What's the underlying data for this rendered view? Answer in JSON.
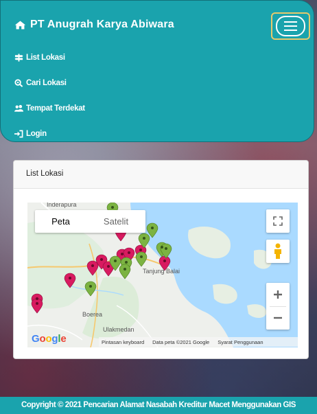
{
  "navbar": {
    "brand": "PT Anugrah Karya Abiwara",
    "links": [
      {
        "label": "List Lokasi",
        "icon": "signpost-icon"
      },
      {
        "label": "Cari Lokasi",
        "icon": "search-location-icon"
      },
      {
        "label": "Tempat Terdekat",
        "icon": "users-icon"
      },
      {
        "label": "Login",
        "icon": "sign-in-icon"
      }
    ],
    "accent": "#1aa3ad",
    "toggler_border": "#e8c96b"
  },
  "card": {
    "title": "List Lokasi"
  },
  "map": {
    "type_buttons": [
      "Peta",
      "Satelit"
    ],
    "selected_type": "Peta",
    "places": [
      "Inderapura",
      "Tanjung Balai",
      "Boerea",
      "Ulakmedan"
    ],
    "logo": "Google",
    "footer": {
      "shortcuts": "Pintasan keyboard",
      "data": "Data peta ©2021 Google",
      "terms": "Syarat Penggunaan"
    },
    "marker_colors": {
      "pink": "#d81b60",
      "green": "#7cb342"
    }
  },
  "footer": {
    "copyright": "Copyright © 2021 Pencarian Alamat Nasabah Kreditur Macet Menggunakan GIS"
  }
}
